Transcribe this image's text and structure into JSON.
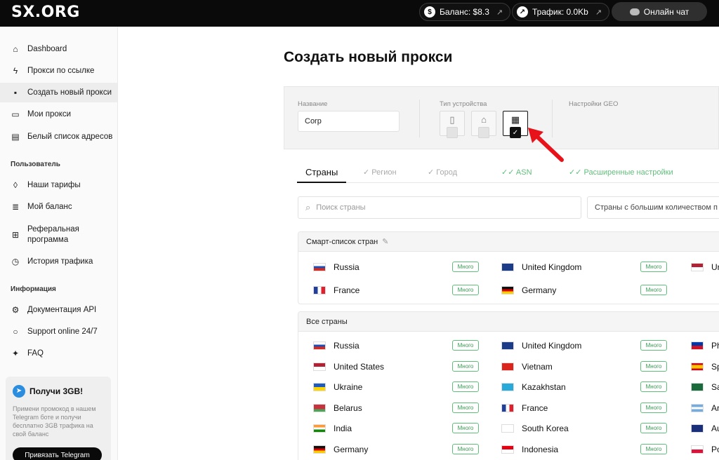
{
  "topbar": {
    "logo": "SX.ORG",
    "balance": "Баланс: $8.3",
    "traffic": "Трафик: 0.0Kb",
    "chat": "Онлайн чат"
  },
  "sidebar": {
    "items": [
      {
        "label": "Dashboard"
      },
      {
        "label": "Прокси по ссылке"
      },
      {
        "label": "Создать новый прокси"
      },
      {
        "label": "Мои прокси"
      },
      {
        "label": "Белый список адресов"
      }
    ],
    "section_user": "Пользователь",
    "user_items": [
      {
        "label": "Наши тарифы"
      },
      {
        "label": "Мой баланс"
      },
      {
        "label": "Реферальная программа"
      },
      {
        "label": "История трафика"
      }
    ],
    "section_info": "Информация",
    "info_items": [
      {
        "label": "Документация API"
      },
      {
        "label": "Support online 24/7"
      },
      {
        "label": "FAQ"
      }
    ],
    "promo": {
      "title": "Получи 3GB!",
      "text": "Примени промокод в нашем Telegram боте и получи бесплатно 3GB трафика на свой баланс",
      "button": "Привязать Telegram"
    }
  },
  "main": {
    "title": "Создать новый прокси",
    "name_label": "Название",
    "name_value": "Corp",
    "device_label": "Тип устройства",
    "geo_label": "Настройки GEO",
    "tabs": [
      {
        "label": "Страны"
      },
      {
        "label": "Регион"
      },
      {
        "label": "Город"
      },
      {
        "label": "ASN"
      },
      {
        "label": "Расширенные настройки"
      }
    ],
    "search_placeholder": "Поиск страны",
    "filter_value": "Страны с большим количеством п",
    "smart_list_title": "Смарт-список стран",
    "all_countries_title": "Все страны",
    "badge": "Много",
    "smart_list": [
      {
        "name": "Russia"
      },
      {
        "name": "United Kingdom"
      },
      {
        "name": "Ur"
      },
      {
        "name": "France"
      },
      {
        "name": "Germany"
      }
    ],
    "all_countries": [
      {
        "name": "Russia"
      },
      {
        "name": "United Kingdom"
      },
      {
        "name": "Ph"
      },
      {
        "name": "United States"
      },
      {
        "name": "Vietnam"
      },
      {
        "name": "Sp"
      },
      {
        "name": "Ukraine"
      },
      {
        "name": "Kazakhstan"
      },
      {
        "name": "Sa"
      },
      {
        "name": "Belarus"
      },
      {
        "name": "France"
      },
      {
        "name": "Ar"
      },
      {
        "name": "India"
      },
      {
        "name": "South Korea"
      },
      {
        "name": "Au"
      },
      {
        "name": "Germany"
      },
      {
        "name": "Indonesia"
      },
      {
        "name": "Po"
      }
    ]
  }
}
